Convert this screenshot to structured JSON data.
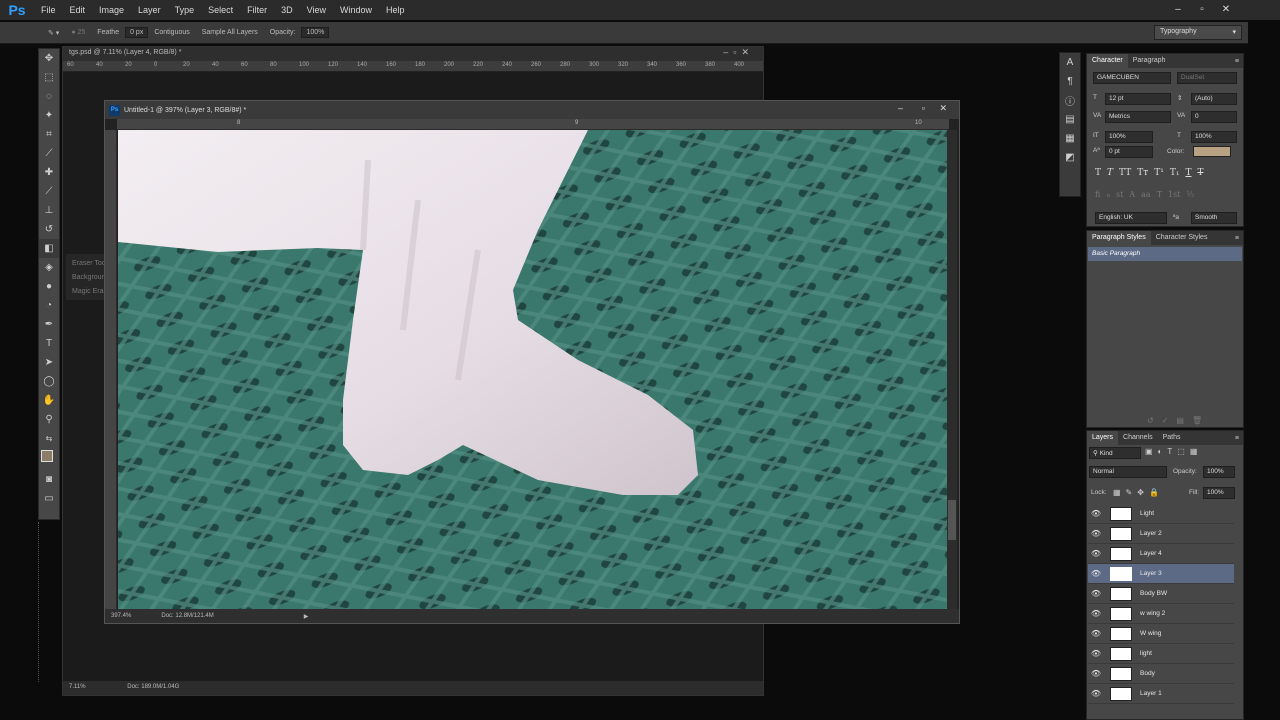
{
  "app": {
    "logo": "Ps",
    "menu": [
      "File",
      "Edit",
      "Image",
      "Layer",
      "Type",
      "Select",
      "Filter",
      "3D",
      "View",
      "Window",
      "Help"
    ],
    "workspace": "Typography"
  },
  "options_bar": {
    "items": [
      "Feathe",
      "0 px",
      "Contiguous",
      "Sample All Layers",
      "Opacity:",
      "100%"
    ]
  },
  "tool_flyout": [
    "Eraser Tool",
    "Background Eraser Tool",
    "Magic Eraser Tool"
  ],
  "bg_document": {
    "tab_title": "tgs.psd @ 7.11% (Layer 4, RGB/8) *",
    "ruler_ticks": [
      "60",
      "40",
      "20",
      "0",
      "20",
      "40",
      "60",
      "80",
      "100",
      "120",
      "140",
      "160",
      "180",
      "200",
      "220",
      "240",
      "260",
      "280",
      "300",
      "320",
      "340",
      "360",
      "380",
      "400"
    ],
    "zoom": "7.11%",
    "doc_size": "Doc: 189.0M/1.04G"
  },
  "document": {
    "title": "Untitled-1 @ 397% (Layer 3, RGB/8#) *",
    "ruler_ticks": [
      "8",
      "9",
      "10"
    ],
    "zoom": "397.4%",
    "doc_size": "Doc: 12.8M/121.4M"
  },
  "character_panel": {
    "tabs": [
      "Character",
      "Paragraph"
    ],
    "font_family": "GAMECUBEN",
    "font_style": "DualSet",
    "font_size": "12 pt",
    "leading": "(Auto)",
    "kerning": "Metrics",
    "tracking": "0",
    "vscale": "100%",
    "hscale": "100%",
    "baseline": "0 pt",
    "color_label": "Color:",
    "color": "#b8a283",
    "language": "English: UK",
    "antialias": "Smooth",
    "aa_label": "ªa"
  },
  "styles_panel": {
    "tabs": [
      "Paragraph Styles",
      "Character Styles"
    ],
    "item": "Basic Paragraph"
  },
  "layers_panel": {
    "tabs": [
      "Layers",
      "Channels",
      "Paths"
    ],
    "filter": "Kind",
    "blend_mode": "Normal",
    "opacity_label": "Opacity:",
    "opacity": "100%",
    "lock_label": "Lock:",
    "fill_label": "Fill:",
    "fill": "100%",
    "layers": [
      {
        "name": "Light",
        "selected": false
      },
      {
        "name": "Layer 2",
        "selected": false
      },
      {
        "name": "Layer 4",
        "selected": false
      },
      {
        "name": "Layer 3",
        "selected": true
      },
      {
        "name": "Body BW",
        "selected": false
      },
      {
        "name": "w wing 2",
        "selected": false
      },
      {
        "name": "W wing",
        "selected": false
      },
      {
        "name": "light",
        "selected": false
      },
      {
        "name": "Body",
        "selected": false
      },
      {
        "name": "Layer 1",
        "selected": false
      }
    ]
  }
}
